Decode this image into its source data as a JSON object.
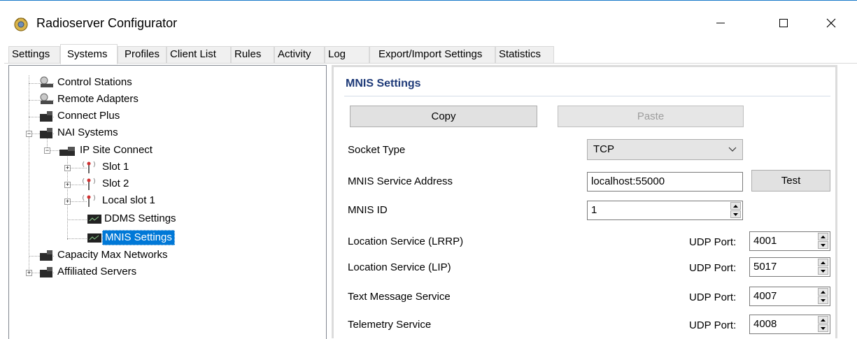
{
  "window": {
    "title": "Radioserver Configurator"
  },
  "tabs": [
    "Settings",
    "Systems",
    "Profiles",
    "Client List",
    "Rules",
    "Activity",
    "Log",
    "Export/Import Settings",
    "Statistics"
  ],
  "tree": {
    "control_stations": "Control Stations",
    "remote_adapters": "Remote Adapters",
    "connect_plus": "Connect Plus",
    "nai_systems": "NAI Systems",
    "ip_site_connect": "IP Site Connect",
    "slot1": "Slot 1",
    "slot2": "Slot 2",
    "local_slot1": "Local slot 1",
    "ddms_settings": "DDMS Settings",
    "mnis_settings": "MNIS Settings",
    "capacity_max": "Capacity Max Networks",
    "affiliated": "Affiliated Servers"
  },
  "panel": {
    "title": "MNIS Settings",
    "copy_label": "Copy",
    "paste_label": "Paste",
    "socket_type_label": "Socket Type",
    "socket_type_value": "TCP",
    "service_address_label": "MNIS Service Address",
    "service_address_value": "localhost:55000",
    "test_label": "Test",
    "mnis_id_label": "MNIS ID",
    "mnis_id_value": "1",
    "udp_port_label": "UDP Port:",
    "services": [
      {
        "label": "Location Service (LRRP)",
        "port": "4001"
      },
      {
        "label": "Location Service (LIP)",
        "port": "5017"
      },
      {
        "label": "Text Message Service",
        "port": "4007"
      },
      {
        "label": "Telemetry Service",
        "port": "4008"
      }
    ]
  }
}
